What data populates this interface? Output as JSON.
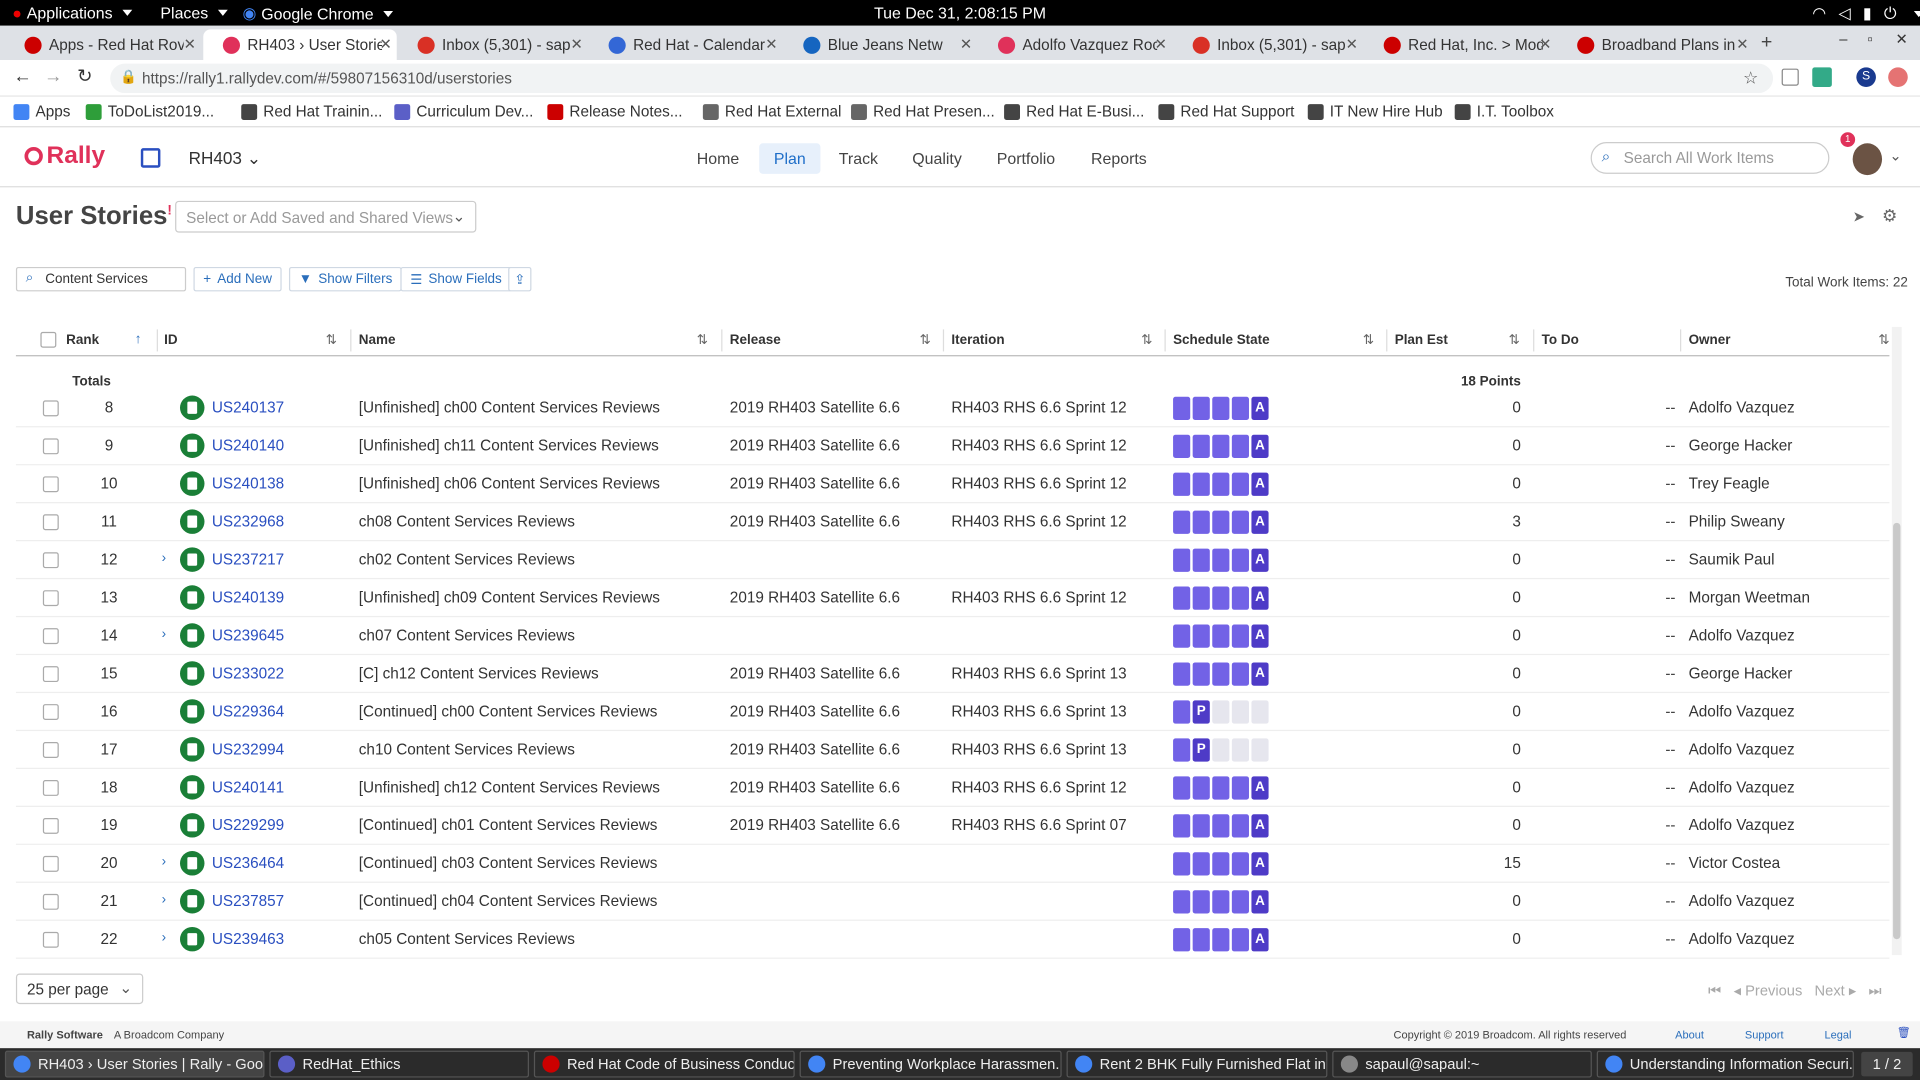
{
  "os": {
    "applications": "Applications",
    "places": "Places",
    "browser": "Google Chrome",
    "clock": "Tue Dec 31,  2:08:15 PM"
  },
  "tabs": [
    {
      "label": "Apps - Red Hat Rov",
      "color": "#cc0000"
    },
    {
      "label": "RH403 › User Storie",
      "color": "#e0315a"
    },
    {
      "label": "Inbox (5,301) - sap",
      "color": "#d93025"
    },
    {
      "label": "Red Hat - Calendar",
      "color": "#3367d6"
    },
    {
      "label": "Blue Jeans Netw",
      "color": "#1565c0"
    },
    {
      "label": "Adolfo Vazquez Roc",
      "color": "#e0315a"
    },
    {
      "label": "Inbox (5,301) - sap",
      "color": "#d93025"
    },
    {
      "label": "Red Hat, Inc. > Mod",
      "color": "#cc0000"
    },
    {
      "label": "Broadband Plans in I",
      "color": "#cc0000"
    }
  ],
  "url": "https://rally1.rallydev.com/#/59807156310d/userstories",
  "bookmarks": [
    {
      "label": "Apps",
      "color": "#4285f4"
    },
    {
      "label": "ToDoList2019...",
      "color": "#2e9e3a"
    },
    {
      "label": "Red Hat Trainin...",
      "color": "#444"
    },
    {
      "label": "Curriculum Dev...",
      "color": "#5b5fc7"
    },
    {
      "label": "Release Notes...",
      "color": "#cc0000"
    },
    {
      "label": "Red Hat External",
      "color": "#666"
    },
    {
      "label": "Red Hat Presen...",
      "color": "#666"
    },
    {
      "label": "Red Hat E-Busi...",
      "color": "#444"
    },
    {
      "label": "Red Hat Support",
      "color": "#444"
    },
    {
      "label": "IT New Hire Hub",
      "color": "#444"
    },
    {
      "label": "I.T. Toolbox",
      "color": "#444"
    }
  ],
  "rally": {
    "logo": "Rally",
    "project": "RH403",
    "nav": [
      "Home",
      "Plan",
      "Track",
      "Quality",
      "Portfolio",
      "Reports"
    ],
    "active_nav": "Plan",
    "search_placeholder": "Search All Work Items",
    "notification_count": "1",
    "accent": "#e0315a"
  },
  "page": {
    "title": "User Stories",
    "views_placeholder": "Select or Add Saved and Shared Views",
    "filter_value": "Content Services",
    "add_new": "Add New",
    "show_filters": "Show Filters",
    "show_fields": "Show Fields",
    "total": "Total Work Items: 22"
  },
  "columns": [
    "Rank",
    "ID",
    "Name",
    "Release",
    "Iteration",
    "Schedule State",
    "Plan Est",
    "To Do",
    "Owner"
  ],
  "totals": {
    "label": "Totals",
    "plan_est": "18 Points"
  },
  "rows": [
    {
      "rank": "8",
      "id": "US240137",
      "name": "[Unfinished] ch00 Content Services Reviews",
      "release": "2019 RH403 Satellite 6.6",
      "iteration": "RH403 RHS 6.6 Sprint 12",
      "state": "A",
      "plan_est": "0",
      "todo": "--",
      "owner": "Adolfo Vazquez",
      "expand": false
    },
    {
      "rank": "9",
      "id": "US240140",
      "name": "[Unfinished] ch11 Content Services Reviews",
      "release": "2019 RH403 Satellite 6.6",
      "iteration": "RH403 RHS 6.6 Sprint 12",
      "state": "A",
      "plan_est": "0",
      "todo": "--",
      "owner": "George Hacker",
      "expand": false
    },
    {
      "rank": "10",
      "id": "US240138",
      "name": "[Unfinished] ch06 Content Services Reviews",
      "release": "2019 RH403 Satellite 6.6",
      "iteration": "RH403 RHS 6.6 Sprint 12",
      "state": "A",
      "plan_est": "0",
      "todo": "--",
      "owner": "Trey Feagle",
      "expand": false
    },
    {
      "rank": "11",
      "id": "US232968",
      "name": "ch08 Content Services Reviews",
      "release": "2019 RH403 Satellite 6.6",
      "iteration": "RH403 RHS 6.6 Sprint 12",
      "state": "A",
      "plan_est": "3",
      "todo": "--",
      "owner": "Philip Sweany",
      "expand": false
    },
    {
      "rank": "12",
      "id": "US237217",
      "name": "ch02 Content Services Reviews",
      "release": "",
      "iteration": "",
      "state": "A",
      "plan_est": "0",
      "todo": "--",
      "owner": "Saumik Paul",
      "expand": true
    },
    {
      "rank": "13",
      "id": "US240139",
      "name": "[Unfinished] ch09 Content Services Reviews",
      "release": "2019 RH403 Satellite 6.6",
      "iteration": "RH403 RHS 6.6 Sprint 12",
      "state": "A",
      "plan_est": "0",
      "todo": "--",
      "owner": "Morgan Weetman",
      "expand": false
    },
    {
      "rank": "14",
      "id": "US239645",
      "name": "ch07 Content Services Reviews",
      "release": "",
      "iteration": "",
      "state": "A",
      "plan_est": "0",
      "todo": "--",
      "owner": "Adolfo Vazquez",
      "expand": true
    },
    {
      "rank": "15",
      "id": "US233022",
      "name": "[C] ch12 Content Services Reviews",
      "release": "2019 RH403 Satellite 6.6",
      "iteration": "RH403 RHS 6.6 Sprint 13",
      "state": "A",
      "plan_est": "0",
      "todo": "--",
      "owner": "George Hacker",
      "expand": false
    },
    {
      "rank": "16",
      "id": "US229364",
      "name": "[Continued] ch00 Content Services Reviews",
      "release": "2019 RH403 Satellite 6.6",
      "iteration": "RH403 RHS 6.6 Sprint 13",
      "state": "P",
      "plan_est": "0",
      "todo": "--",
      "owner": "Adolfo Vazquez",
      "expand": false
    },
    {
      "rank": "17",
      "id": "US232994",
      "name": "ch10 Content Services Reviews",
      "release": "2019 RH403 Satellite 6.6",
      "iteration": "RH403 RHS 6.6 Sprint 13",
      "state": "P",
      "plan_est": "0",
      "todo": "--",
      "owner": "Adolfo Vazquez",
      "expand": false
    },
    {
      "rank": "18",
      "id": "US240141",
      "name": "[Unfinished] ch12 Content Services Reviews",
      "release": "2019 RH403 Satellite 6.6",
      "iteration": "RH403 RHS 6.6 Sprint 12",
      "state": "A",
      "plan_est": "0",
      "todo": "--",
      "owner": "Adolfo Vazquez",
      "expand": false
    },
    {
      "rank": "19",
      "id": "US229299",
      "name": "[Continued] ch01 Content Services Reviews",
      "release": "2019 RH403 Satellite 6.6",
      "iteration": "RH403 RHS 6.6 Sprint 07",
      "state": "A",
      "plan_est": "0",
      "todo": "--",
      "owner": "Adolfo Vazquez",
      "expand": false
    },
    {
      "rank": "20",
      "id": "US236464",
      "name": "[Continued] ch03 Content Services Reviews",
      "release": "",
      "iteration": "",
      "state": "A",
      "plan_est": "15",
      "todo": "--",
      "owner": "Victor Costea",
      "expand": true
    },
    {
      "rank": "21",
      "id": "US237857",
      "name": "[Continued] ch04 Content Services Reviews",
      "release": "",
      "iteration": "",
      "state": "A",
      "plan_est": "0",
      "todo": "--",
      "owner": "Adolfo Vazquez",
      "expand": true
    },
    {
      "rank": "22",
      "id": "US239463",
      "name": "ch05 Content Services Reviews",
      "release": "",
      "iteration": "",
      "state": "A",
      "plan_est": "0",
      "todo": "--",
      "owner": "Adolfo Vazquez",
      "expand": true
    }
  ],
  "pager": {
    "per_page": "25 per page",
    "previous": "Previous",
    "next": "Next"
  },
  "footer": {
    "brand": "Rally Software",
    "company": "A Broadcom Company",
    "copyright": "Copyright © 2019 Broadcom. All rights reserved",
    "about": "About",
    "support": "Support",
    "legal": "Legal"
  },
  "taskbar": [
    {
      "label": "RH403 › User Stories | Rally - Goo...",
      "color": "#4285f4"
    },
    {
      "label": "RedHat_Ethics",
      "color": "#5b5fc7"
    },
    {
      "label": "Red Hat Code of Business Conduc...",
      "color": "#cc0000"
    },
    {
      "label": "Preventing Workplace Harassmen...",
      "color": "#4285f4"
    },
    {
      "label": "Rent 2 BHK Fully Furnished Flat in...",
      "color": "#4285f4"
    },
    {
      "label": "sapaul@sapaul:~",
      "color": "#888"
    },
    {
      "label": "Understanding Information Securi...",
      "color": "#4285f4"
    }
  ],
  "workspace": "1 / 2"
}
